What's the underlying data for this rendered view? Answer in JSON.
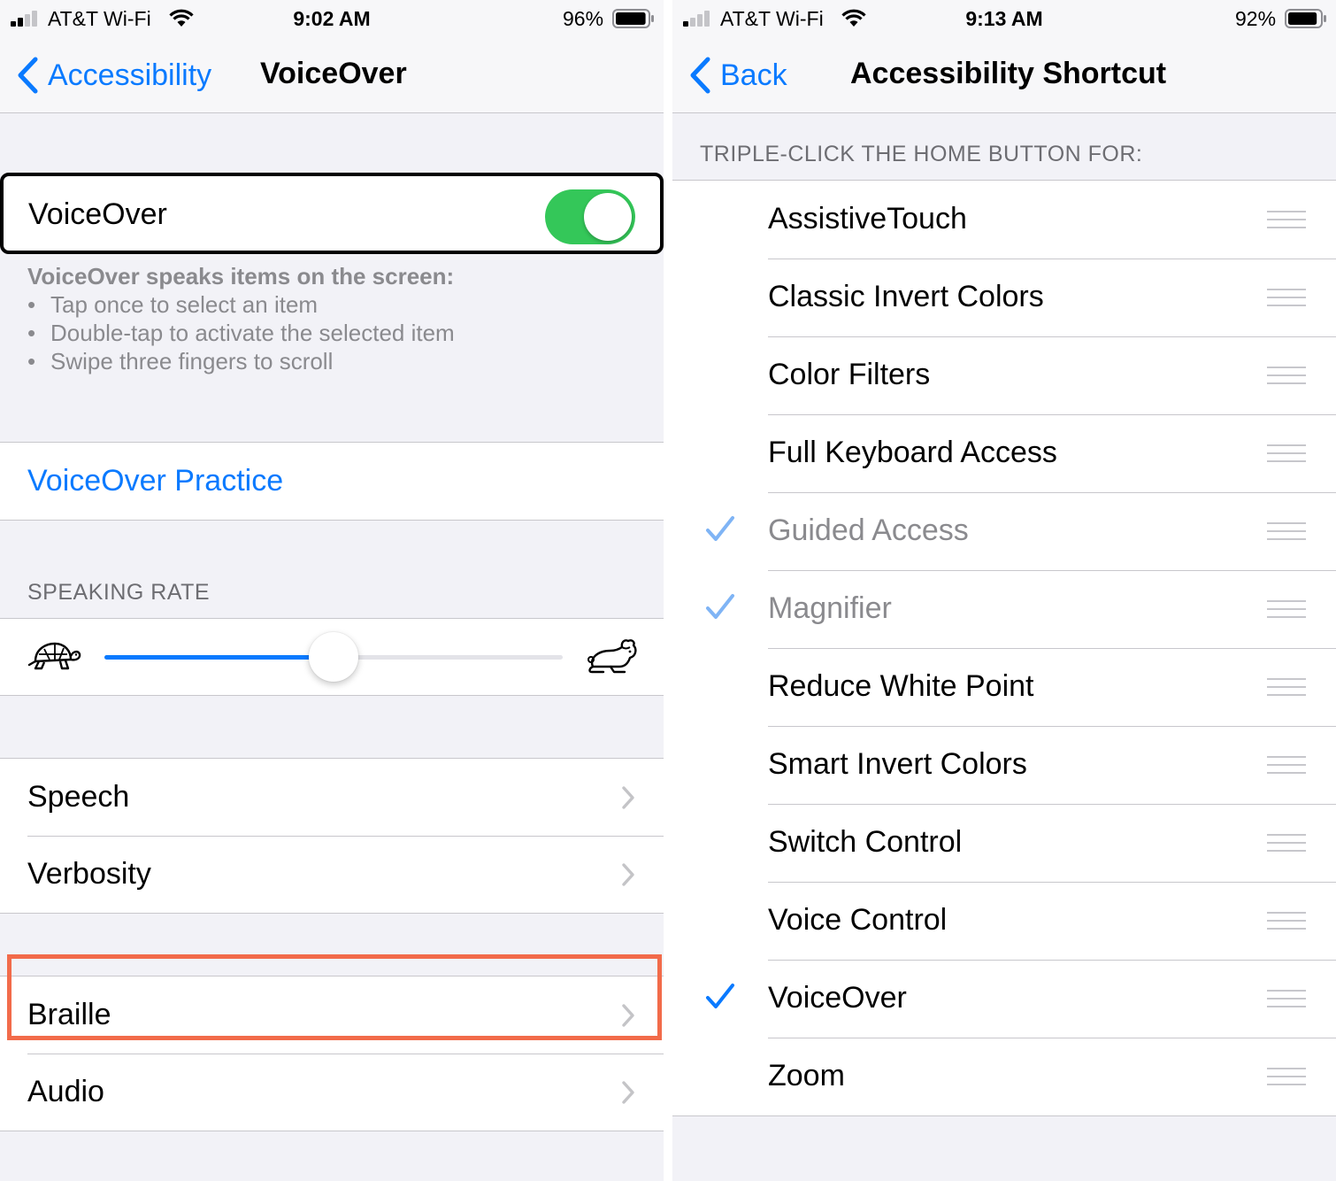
{
  "left": {
    "status": {
      "carrier": "AT&T Wi-Fi",
      "time": "9:02 AM",
      "battery": "96%",
      "battery_level": 0.96
    },
    "nav": {
      "back_label": "Accessibility",
      "title": "VoiceOver"
    },
    "voiceover_toggle": {
      "label": "VoiceOver",
      "on": true
    },
    "description": {
      "heading": "VoiceOver speaks items on the screen:",
      "bullets": [
        "Tap once to select an item",
        "Double-tap to activate the selected item",
        "Swipe three fingers to scroll"
      ]
    },
    "practice_label": "VoiceOver Practice",
    "speaking_rate": {
      "header": "SPEAKING RATE",
      "value": 0.5
    },
    "group1": [
      "Speech",
      "Verbosity"
    ],
    "group2": [
      "Braille",
      "Audio"
    ],
    "colors": {
      "accent": "#0a7aff",
      "switch_on": "#34c759"
    }
  },
  "right": {
    "status": {
      "carrier": "AT&T Wi-Fi",
      "time": "9:13 AM",
      "battery": "92%",
      "battery_level": 0.92
    },
    "nav": {
      "back_label": "Back",
      "title": "Accessibility Shortcut"
    },
    "section_header": "TRIPLE-CLICK THE HOME BUTTON FOR:",
    "items": [
      {
        "label": "AssistiveTouch",
        "checked": false,
        "dimmed": false
      },
      {
        "label": "Classic Invert Colors",
        "checked": false,
        "dimmed": false
      },
      {
        "label": "Color Filters",
        "checked": false,
        "dimmed": false
      },
      {
        "label": "Full Keyboard Access",
        "checked": false,
        "dimmed": false
      },
      {
        "label": "Guided Access",
        "checked": true,
        "dimmed": true
      },
      {
        "label": "Magnifier",
        "checked": true,
        "dimmed": true
      },
      {
        "label": "Reduce White Point",
        "checked": false,
        "dimmed": false
      },
      {
        "label": "Smart Invert Colors",
        "checked": false,
        "dimmed": false
      },
      {
        "label": "Switch Control",
        "checked": false,
        "dimmed": false
      },
      {
        "label": "Voice Control",
        "checked": false,
        "dimmed": false
      },
      {
        "label": "VoiceOver",
        "checked": true,
        "dimmed": false,
        "highlighted": true
      },
      {
        "label": "Zoom",
        "checked": false,
        "dimmed": false
      }
    ],
    "colors": {
      "highlight": "#f26b4a",
      "check": "#0a7aff",
      "check_dim": "#7fb4f5"
    }
  }
}
